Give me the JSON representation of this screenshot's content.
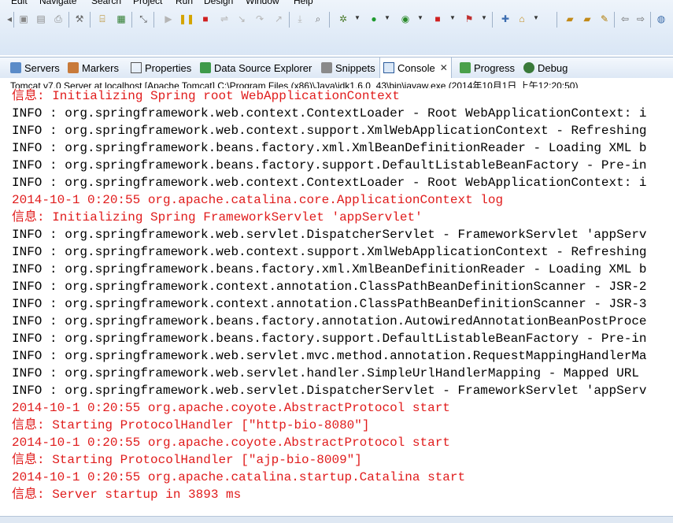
{
  "menu": [
    "Edit",
    "Navigate",
    "Search",
    "Project",
    "Run",
    "Design",
    "Window",
    "Help"
  ],
  "toolbar_icons": [
    "new-icon",
    "save-icon",
    "save-all-icon",
    "print-icon",
    "build-icon",
    "open-type-icon",
    "new-class-icon",
    "pin-icon",
    "skip-breakpoints-icon",
    "resume-icon",
    "suspend-icon",
    "terminate-icon",
    "disconnect-icon",
    "step-into-icon",
    "step-over-icon",
    "step-return-icon",
    "drop-to-frame-icon",
    "use-step-filters-icon",
    "debug-icon",
    "run-icon",
    "coverage-icon",
    "stop-server-icon",
    "external-tools-icon",
    "new-server-icon",
    "open-folder-icon",
    "open-project-icon",
    "back-icon",
    "forward-icon",
    "globe-icon"
  ],
  "colors": {
    "error_text": "#e01b1b",
    "info_text": "#000000",
    "chrome_bg": "#d9e6f5"
  },
  "tabs": [
    {
      "label": "Servers",
      "icon": "servers-icon"
    },
    {
      "label": "Markers",
      "icon": "markers-icon"
    },
    {
      "label": "Properties",
      "icon": "properties-icon"
    },
    {
      "label": "Data Source Explorer",
      "icon": "data-source-icon"
    },
    {
      "label": "Snippets",
      "icon": "snippets-icon"
    },
    {
      "label": "Console",
      "icon": "console-icon",
      "active": true
    },
    {
      "label": "Progress",
      "icon": "progress-icon"
    },
    {
      "label": "Debug",
      "icon": "debug-icon"
    }
  ],
  "process_label": "Tomcat v7.0 Server at localhost [Apache Tomcat] C:\\Program Files (x86)\\Java\\jdk1.6.0_43\\bin\\javaw.exe (2014年10月1日 上午12:20:50)",
  "console_lines": [
    {
      "text": "信息: Initializing Spring root WebApplicationContext",
      "level": "err"
    },
    {
      "text": "INFO : org.springframework.web.context.ContextLoader - Root WebApplicationContext: i",
      "level": "info"
    },
    {
      "text": "INFO : org.springframework.web.context.support.XmlWebApplicationContext - Refreshing",
      "level": "info"
    },
    {
      "text": "INFO : org.springframework.beans.factory.xml.XmlBeanDefinitionReader - Loading XML b",
      "level": "info"
    },
    {
      "text": "INFO : org.springframework.beans.factory.support.DefaultListableBeanFactory - Pre-in",
      "level": "info"
    },
    {
      "text": "INFO : org.springframework.web.context.ContextLoader - Root WebApplicationContext: i",
      "level": "info"
    },
    {
      "text": "2014-10-1 0:20:55 org.apache.catalina.core.ApplicationContext log",
      "level": "err"
    },
    {
      "text": "信息: Initializing Spring FrameworkServlet 'appServlet'",
      "level": "err"
    },
    {
      "text": "INFO : org.springframework.web.servlet.DispatcherServlet - FrameworkServlet 'appServ",
      "level": "info"
    },
    {
      "text": "INFO : org.springframework.web.context.support.XmlWebApplicationContext - Refreshing",
      "level": "info"
    },
    {
      "text": "INFO : org.springframework.beans.factory.xml.XmlBeanDefinitionReader - Loading XML b",
      "level": "info"
    },
    {
      "text": "INFO : org.springframework.context.annotation.ClassPathBeanDefinitionScanner - JSR-2",
      "level": "info"
    },
    {
      "text": "INFO : org.springframework.context.annotation.ClassPathBeanDefinitionScanner - JSR-3",
      "level": "info"
    },
    {
      "text": "INFO : org.springframework.beans.factory.annotation.AutowiredAnnotationBeanPostProce",
      "level": "info"
    },
    {
      "text": "INFO : org.springframework.beans.factory.support.DefaultListableBeanFactory - Pre-in",
      "level": "info"
    },
    {
      "text": "INFO : org.springframework.web.servlet.mvc.method.annotation.RequestMappingHandlerMa",
      "level": "info"
    },
    {
      "text": "INFO : org.springframework.web.servlet.handler.SimpleUrlHandlerMapping - Mapped URL ",
      "level": "info"
    },
    {
      "text": "INFO : org.springframework.web.servlet.DispatcherServlet - FrameworkServlet 'appServ",
      "level": "info"
    },
    {
      "text": "2014-10-1 0:20:55 org.apache.coyote.AbstractProtocol start",
      "level": "err"
    },
    {
      "text": "信息: Starting ProtocolHandler [\"http-bio-8080\"]",
      "level": "err"
    },
    {
      "text": "2014-10-1 0:20:55 org.apache.coyote.AbstractProtocol start",
      "level": "err"
    },
    {
      "text": "信息: Starting ProtocolHandler [\"ajp-bio-8009\"]",
      "level": "err"
    },
    {
      "text": "2014-10-1 0:20:55 org.apache.catalina.startup.Catalina start",
      "level": "err"
    },
    {
      "text": "信息: Server startup in 3893 ms",
      "level": "err"
    }
  ]
}
